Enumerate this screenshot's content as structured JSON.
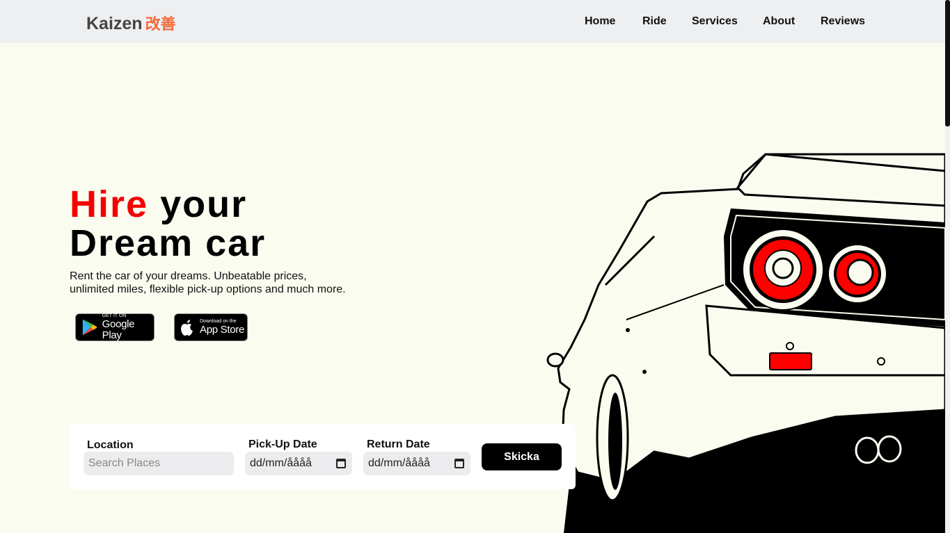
{
  "logo": {
    "name": "Kaizen",
    "kanji": "改善"
  },
  "nav": {
    "items": [
      "Home",
      "Ride",
      "Services",
      "About",
      "Reviews"
    ]
  },
  "hero": {
    "title_red": "Hire",
    "title_rest_line1": "your",
    "title_line2": "Dream car",
    "subtitle_line1": "Rent the car of your dreams. Unbeatable prices,",
    "subtitle_line2": "unlimited miles, flexible pick-up options and much more."
  },
  "badges": {
    "google": {
      "small": "GET IT ON",
      "big": "Google Play"
    },
    "apple": {
      "small": "Download on the",
      "big": "App Store"
    }
  },
  "booking": {
    "location_label": "Location",
    "location_placeholder": "Search Places",
    "pickup_label": "Pick-Up Date",
    "pickup_value": "dd/mm/åååå",
    "return_label": "Return Date",
    "return_value": "dd/mm/åååå",
    "submit_label": "Skicka"
  },
  "colors": {
    "accent": "#f50000",
    "logo_kanji": "#f26b3a",
    "background": "#fafcf0"
  }
}
